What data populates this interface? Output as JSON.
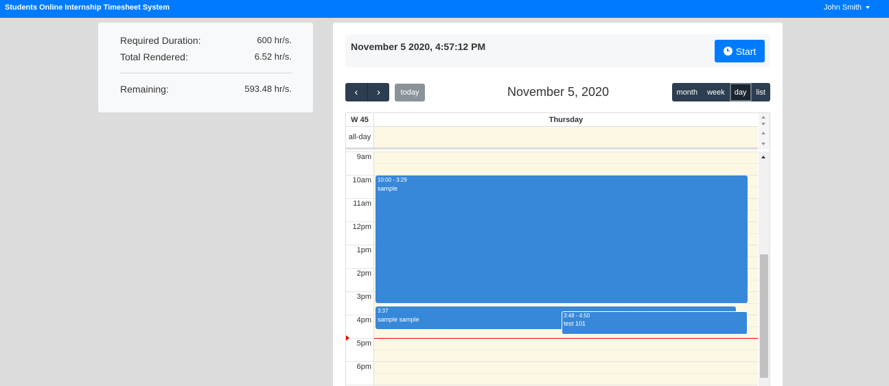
{
  "navbar": {
    "brand": "Students Online Internship Timesheet System",
    "user": "John Smith"
  },
  "summary": {
    "required_label": "Required Duration:",
    "required_value": "600 hr/s.",
    "rendered_label": "Total Rendered:",
    "rendered_value": "6.52 hr/s.",
    "remaining_label": "Remaining:",
    "remaining_value": "593.48 hr/s."
  },
  "clock": {
    "datetime": "November 5 2020, 4:57:12 PM",
    "start_label": "Start",
    "start_icon": "clock-icon"
  },
  "calendar": {
    "prev_icon": "chevron-left-icon",
    "next_icon": "chevron-right-icon",
    "prev_glyph": "‹",
    "next_glyph": "›",
    "today_label": "today",
    "title": "November 5, 2020",
    "views": [
      "month",
      "week",
      "day",
      "list"
    ],
    "active_view": "day",
    "week_label": "W 45",
    "day_header": "Thursday",
    "allday_label": "all-day",
    "time_labels": [
      "9am",
      "10am",
      "11am",
      "12pm",
      "1pm",
      "2pm",
      "3pm",
      "4pm",
      "5pm",
      "6pm"
    ],
    "events": [
      {
        "time": "10:00 - 3:29",
        "name": "sample"
      },
      {
        "time": "3:37",
        "name": "sample sample"
      },
      {
        "time": "3:48 - 4:50",
        "name": "test 101"
      }
    ]
  },
  "colors": {
    "primary": "#007bff",
    "event": "#3788d8",
    "dark_button": "#2c3e50",
    "highlight_today": "#fcf8e3",
    "now_indicator": "#ee0000"
  }
}
